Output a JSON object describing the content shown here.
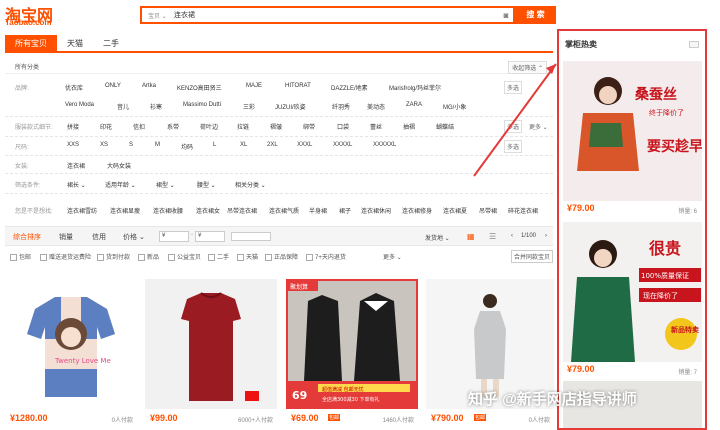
{
  "brand": {
    "logo_cn": "淘宝网",
    "logo_en": "Taobao.com",
    "color": "#ff5000"
  },
  "search": {
    "scope": "宝贝",
    "value": "连衣裙",
    "button": "搜 索"
  },
  "tabs": [
    "所有宝贝",
    "天猫",
    "二手"
  ],
  "crumb": {
    "label": "所有分类",
    "collapse": "收起筛选"
  },
  "filters": [
    {
      "label": "品牌:",
      "values": [
        "优衣库",
        "ONLY",
        "Artka",
        "KENZO高田贤三",
        "MAJE",
        "HITORAT",
        "DAZZLE/地素",
        "Marisfrolg/玛丝菲尔",
        "Vero Moda",
        "音儿",
        "衫寒",
        "Massimo Dutti",
        "三彩",
        "JUZUI/玖姿",
        "纤羽秀",
        "美动态",
        "ZARA",
        "MG/小象"
      ],
      "more": "多选"
    },
    {
      "label": "服装款式细节:",
      "values": [
        "拼接",
        "印花",
        "信扣",
        "系带",
        "荷叶边",
        "拉链",
        "褶皱",
        "绑带",
        "口袋",
        "蕾丝",
        "抽褶",
        "蝴蝶结"
      ],
      "more": "多选",
      "more2": "更多"
    },
    {
      "label": "尺码:",
      "values": [
        "XXS",
        "XS",
        "S",
        "M",
        "均码",
        "L",
        "XL",
        "2XL",
        "XXXL",
        "XXXXL",
        "XXXXXL"
      ],
      "more": "多选"
    },
    {
      "label": "女装:",
      "values": [
        "连衣裙",
        "大码女装"
      ]
    },
    {
      "label": "筛选条件:",
      "values": [
        "裙长",
        "适用年龄",
        "裙型",
        "腰型",
        "相关分类"
      ]
    },
    {
      "label": "您是不是想找:",
      "values": [
        "连衣裙雪纺",
        "连衣裙显瘦",
        "连衣裙收腰",
        "连衣裙女",
        "吊带连衣裙",
        "连衣裙气质",
        "半身裙",
        "裙子",
        "连衣裙休闲",
        "连衣裙修身",
        "连衣裙夏",
        "吊带裙",
        "碎花连衣裙"
      ]
    }
  ],
  "sort": {
    "items": [
      "综合排序",
      "销量",
      "信用",
      "价格"
    ],
    "price_from": "¥",
    "price_to": "¥",
    "ship": "发货地",
    "page": "1/100"
  },
  "checks": {
    "items": [
      "包邮",
      "赠送退货运费险",
      "货到付款",
      "新品",
      "公益宝贝",
      "二手",
      "天猫",
      "正品保障",
      "7+天内退货"
    ],
    "more": "更多",
    "merge": "合并同款宝贝"
  },
  "cards": [
    {
      "price": "¥1280.00",
      "sales": "0人付款",
      "text": "Twenty Love Me"
    },
    {
      "price": "¥99.00",
      "sales": "6000+人付款",
      "text": ""
    },
    {
      "price": "¥69.00",
      "sales": "1460人付款",
      "badge": "包邮",
      "text": "蓝色款式 69 ¥69",
      "promo1": "聚划算",
      "promo2": "超值满减 包邮无忧",
      "promo3": "全店满300减30 下单有礼"
    },
    {
      "price": "¥790.00",
      "sales": "0人付款",
      "badge": "包邮",
      "text": ""
    }
  ],
  "sidebar": {
    "title": "掌柜热卖",
    "items": [
      {
        "price": "¥79.00",
        "sales": "销量: 6",
        "text1": "桑蚕丝",
        "text2": "终于降价了",
        "text3": "要买趁早"
      },
      {
        "price": "¥79.00",
        "sales": "销量: 7",
        "text1": "很贵",
        "text2": "100%质量保证",
        "text3": "现在降价了",
        "text4": "新品特卖"
      }
    ]
  },
  "watermark": "知乎 @新手网店指导讲师"
}
